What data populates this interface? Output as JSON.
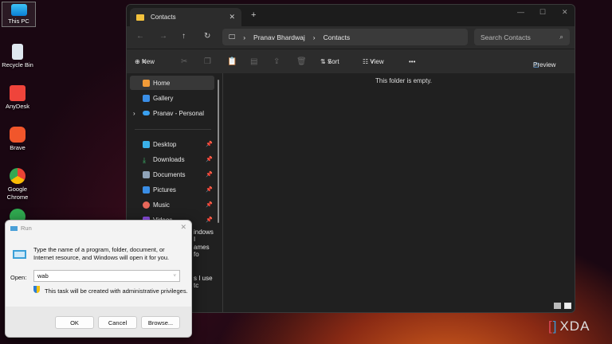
{
  "desktop": {
    "icons": [
      "This PC",
      "Recycle Bin",
      "AnyDesk",
      "Brave",
      "Google Chrome"
    ]
  },
  "explorer": {
    "tab_title": "Contacts",
    "new_tab": "+",
    "breadcrumb": [
      "Pranav Bhardwaj",
      "Contacts"
    ],
    "search_placeholder": "Search Contacts",
    "toolbar": {
      "new": "New",
      "sort": "Sort",
      "view": "View",
      "more": "•••",
      "preview": "Preview"
    },
    "sidebar": {
      "top": [
        "Home",
        "Gallery",
        "Pranav - Personal"
      ],
      "pinned": [
        "Desktop",
        "Downloads",
        "Documents",
        "Pictures",
        "Music",
        "Videos"
      ],
      "partial": [
        "indows I",
        "ames fo",
        "s I use tc"
      ]
    },
    "empty_message": "This folder is empty."
  },
  "run": {
    "title": "Run",
    "description": "Type the name of a program, folder, document, or Internet resource, and Windows will open it for you.",
    "open_label": "Open:",
    "open_value": "wab",
    "admin_note": "This task will be created with administrative privileges.",
    "ok": "OK",
    "cancel": "Cancel",
    "browse": "Browse..."
  },
  "watermark": "XDA"
}
